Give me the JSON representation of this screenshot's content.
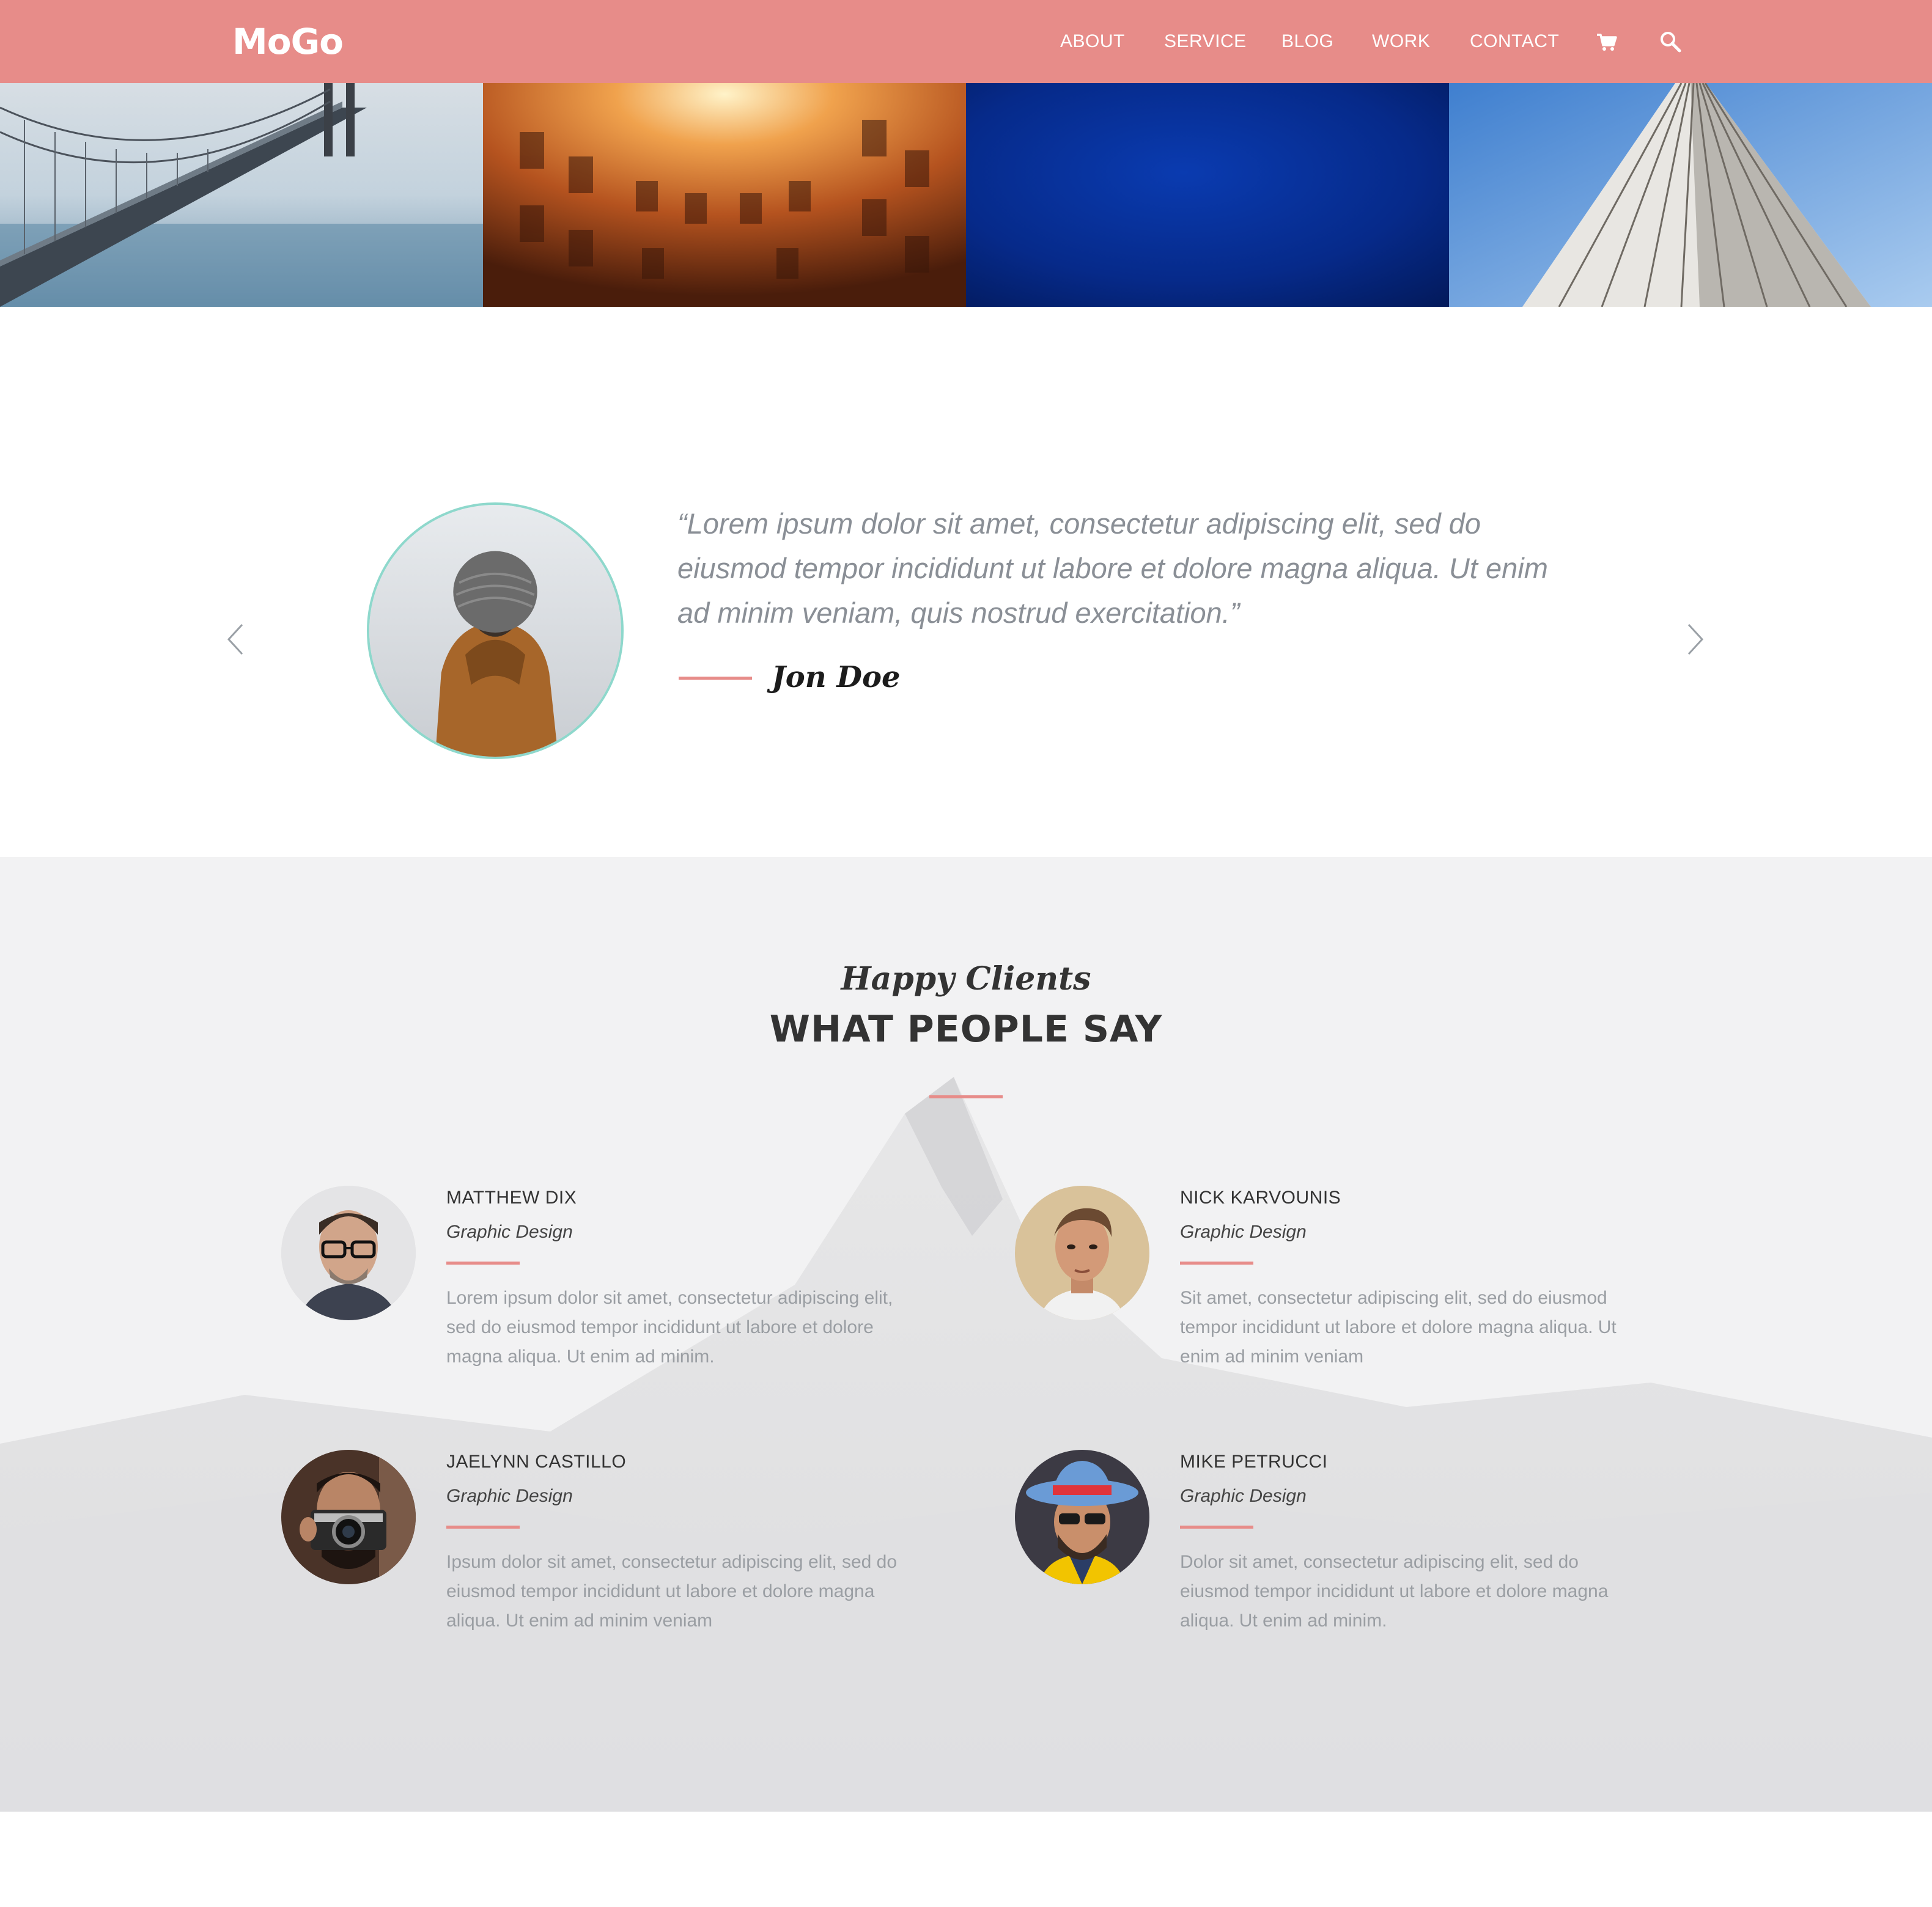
{
  "header": {
    "logo": "MoGo",
    "nav": [
      {
        "label": "ABOUT"
      },
      {
        "label": "SERVICE"
      },
      {
        "label": "BLOG"
      },
      {
        "label": "WORK"
      },
      {
        "label": "CONTACT"
      }
    ],
    "icons": [
      "cart-icon",
      "search-icon"
    ]
  },
  "hero": {
    "panels": [
      "bridge-photo",
      "building-courtyard-photo",
      "blue-photo",
      "skyscraper-photo"
    ]
  },
  "testimonial": {
    "quote": "“Lorem ipsum dolor sit amet, consectetur adipiscing elit, sed do eiusmod tempor incididunt ut labore et dolore magna aliqua. Ut enim ad minim veniam, quis nostrud exercitation.”",
    "author": "Jon Doe",
    "icons": [
      "chevron-left-icon",
      "chevron-right-icon"
    ]
  },
  "clients": {
    "subheading": "Happy Clients",
    "heading": "WHAT PEOPLE SAY",
    "reviews": [
      {
        "name": "MATTHEW DIX",
        "role": "Graphic Design",
        "text": "Lorem ipsum dolor sit amet, consectetur adipiscing elit, sed do eiusmod tempor incididunt ut labore et dolore magna aliqua. Ut enim ad minim."
      },
      {
        "name": "NICK KARVOUNIS",
        "role": "Graphic Design",
        "text": "Sit amet, consectetur adipiscing elit, sed do eiusmod tempor incididunt ut labore et dolore magna aliqua. Ut enim ad minim veniam"
      },
      {
        "name": "JAELYNN CASTILLO",
        "role": "Graphic Design",
        "text": "Ipsum dolor sit amet, consectetur adipiscing elit, sed do eiusmod tempor incididunt ut labore et dolore magna aliqua. Ut enim ad minim veniam"
      },
      {
        "name": "MIKE PETRUCCI",
        "role": "Graphic Design",
        "text": "Dolor sit amet, consectetur adipiscing elit, sed do eiusmod tempor incididunt ut labore et dolore magna aliqua. Ut enim ad minim."
      }
    ]
  },
  "colors": {
    "accent": "#e78c89",
    "avatar_ring": "#8ed8cc",
    "heading": "#333333",
    "body_text": "#9a9ea3",
    "section_bg": "#f1f1f2"
  }
}
